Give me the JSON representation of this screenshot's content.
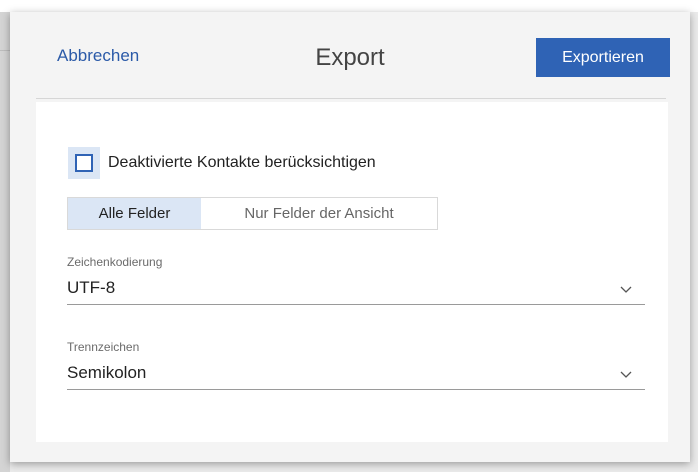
{
  "dialog": {
    "cancel_label": "Abbrechen",
    "title": "Export",
    "export_label": "Exportieren"
  },
  "options": {
    "include_disabled_label": "Deaktivierte Kontakte berücksichtigen",
    "include_disabled_checked": false,
    "field_scope": {
      "active": "Alle Felder",
      "options": [
        "Alle Felder",
        "Nur Felder der Ansicht"
      ]
    },
    "encoding": {
      "label": "Zeichenkodierung",
      "value": "UTF-8"
    },
    "separator": {
      "label": "Trennzeichen",
      "value": "Semikolon"
    }
  },
  "icons": {
    "checkbox": "checkbox-unchecked-icon",
    "dropdown": "chevron-down-icon"
  },
  "colors": {
    "accent": "#2f63b5",
    "link": "#2b5aa8",
    "selected_bg": "#dbe6f5"
  }
}
